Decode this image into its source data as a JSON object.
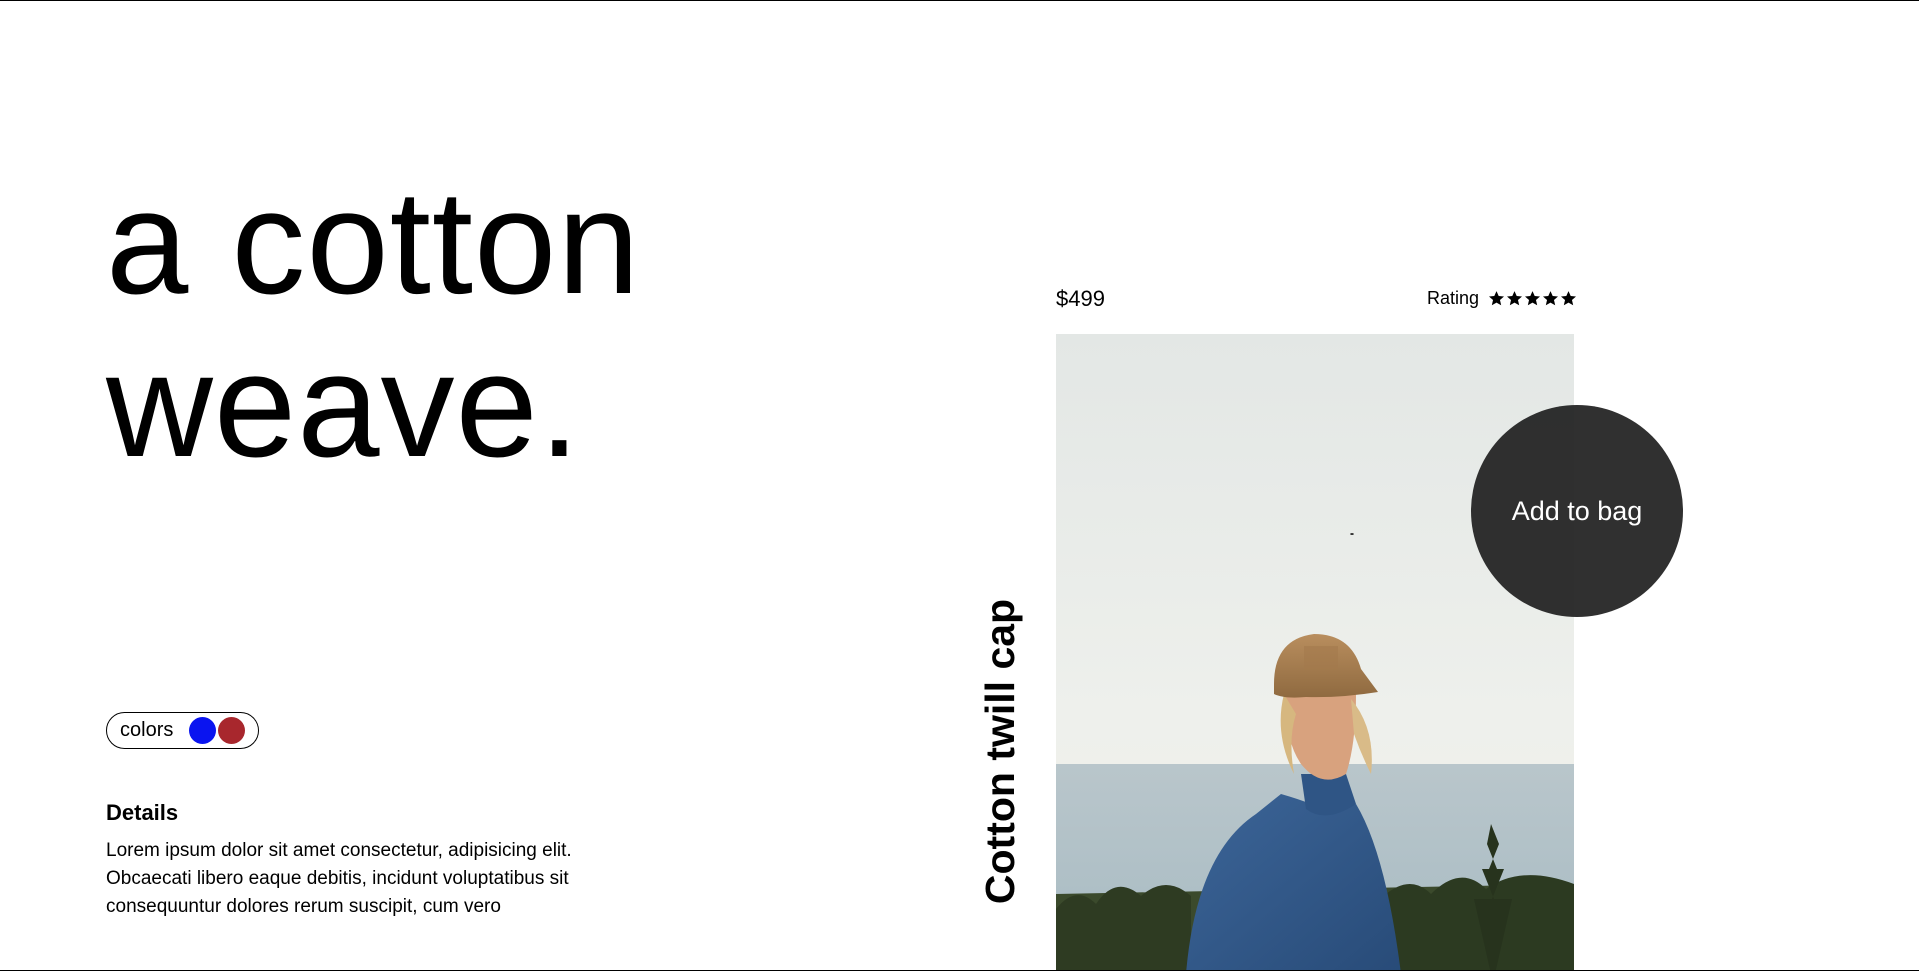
{
  "headline": {
    "line1": "a cotton",
    "line2": "weave."
  },
  "colors": {
    "label": "colors",
    "swatches": [
      {
        "name": "blue",
        "hex": "#0a14f0"
      },
      {
        "name": "red",
        "hex": "#a8272d"
      }
    ]
  },
  "details": {
    "title": "Details",
    "body": "Lorem ipsum dolor sit amet consectetur, adipisicing elit. Obcaecati libero eaque debitis, incidunt voluptatibus sit consequuntur dolores rerum suscipit, cum vero"
  },
  "product": {
    "price": "$499",
    "rating_label": "Rating",
    "rating_stars": 5,
    "name": "Cotton twill cap",
    "add_to_bag": "Add to bag"
  },
  "colors_theme": {
    "button_bg": "#202020",
    "text": "#000000"
  }
}
